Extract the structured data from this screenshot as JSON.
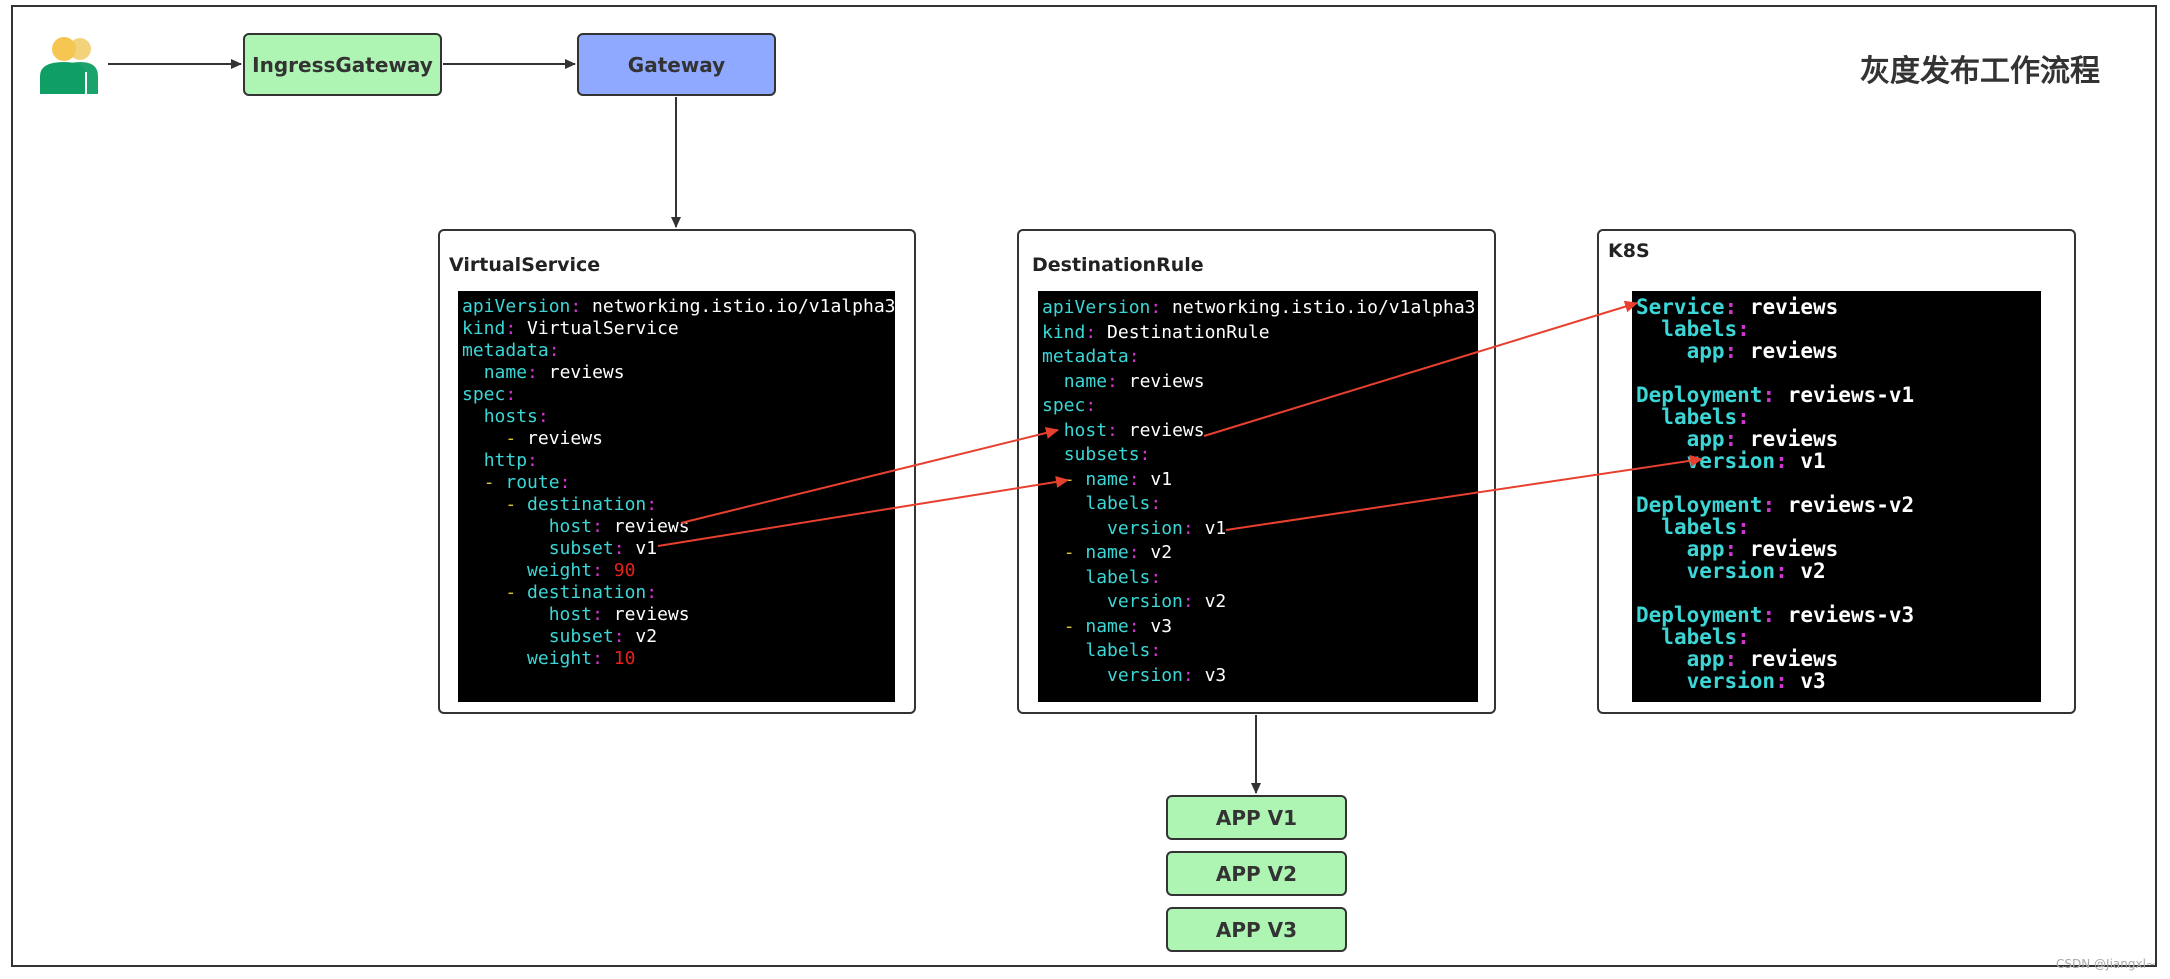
{
  "title": "灰度发布工作流程",
  "colors": {
    "flow_green": "#aef5b4",
    "gateway_blue": "#8ea9ff",
    "arrow_red": "#e8402f",
    "code_key": "#3cd6d6",
    "code_punct": "#d236d2",
    "code_number": "#e8201c",
    "code_dash": "#d7c738"
  },
  "icons": {
    "user": "users-icon"
  },
  "flow": {
    "ingress": "IngressGateway",
    "gateway": "Gateway"
  },
  "panels": {
    "virtualservice": {
      "title": "VirtualService",
      "code": [
        [
          "apiVersion",
          ":",
          " networking.istio.io/v1alpha3"
        ],
        [
          "kind",
          ":",
          " VirtualService"
        ],
        [
          "metadata",
          ":"
        ],
        [
          "  name",
          ":",
          " reviews"
        ],
        [
          "spec",
          ":"
        ],
        [
          "  hosts",
          ":"
        ],
        [
          "    - reviews"
        ],
        [
          "  http",
          ":"
        ],
        [
          "  - route",
          ":"
        ],
        [
          "    - destination",
          ":"
        ],
        [
          "        host",
          ":",
          " reviews"
        ],
        [
          "        subset",
          ":",
          " v1"
        ],
        [
          "      weight",
          ":",
          " 90"
        ],
        [
          "    - destination",
          ":"
        ],
        [
          "        host",
          ":",
          " reviews"
        ],
        [
          "        subset",
          ":",
          " v2"
        ],
        [
          "      weight",
          ":",
          " 10"
        ]
      ]
    },
    "destinationrule": {
      "title": "DestinationRule",
      "code": [
        [
          "apiVersion",
          ":",
          " networking.istio.io/v1alpha3"
        ],
        [
          "kind",
          ":",
          " DestinationRule"
        ],
        [
          "metadata",
          ":"
        ],
        [
          "  name",
          ":",
          " reviews"
        ],
        [
          "spec",
          ":"
        ],
        [
          "  host",
          ":",
          " reviews"
        ],
        [
          "  subsets",
          ":"
        ],
        [
          "  - name",
          ":",
          " v1"
        ],
        [
          "    labels",
          ":"
        ],
        [
          "      version",
          ":",
          " v1"
        ],
        [
          "  - name",
          ":",
          " v2"
        ],
        [
          "    labels",
          ":"
        ],
        [
          "      version",
          ":",
          " v2"
        ],
        [
          "  - name",
          ":",
          " v3"
        ],
        [
          "    labels",
          ":"
        ],
        [
          "      version",
          ":",
          " v3"
        ]
      ]
    },
    "k8s": {
      "title": "K8S",
      "code": [
        [
          "Service",
          ":",
          " reviews"
        ],
        [
          "  labels",
          ":"
        ],
        [
          "    app",
          ":",
          " reviews"
        ],
        [
          ""
        ],
        [
          "Deployment",
          ":",
          " reviews-v1"
        ],
        [
          "  labels",
          ":"
        ],
        [
          "    app",
          ":",
          " reviews"
        ],
        [
          "    version",
          ":",
          " v1"
        ],
        [
          ""
        ],
        [
          "Deployment",
          ":",
          " reviews-v2"
        ],
        [
          "  labels",
          ":"
        ],
        [
          "    app",
          ":",
          " reviews"
        ],
        [
          "    version",
          ":",
          " v2"
        ],
        [
          ""
        ],
        [
          "Deployment",
          ":",
          " reviews-v3"
        ],
        [
          "  labels",
          ":"
        ],
        [
          "    app",
          ":",
          " reviews"
        ],
        [
          "    version",
          ":",
          " v3"
        ]
      ]
    }
  },
  "apps": [
    "APP V1",
    "APP V2",
    "APP V3"
  ],
  "watermark": "CSDN @Jiangxl~"
}
